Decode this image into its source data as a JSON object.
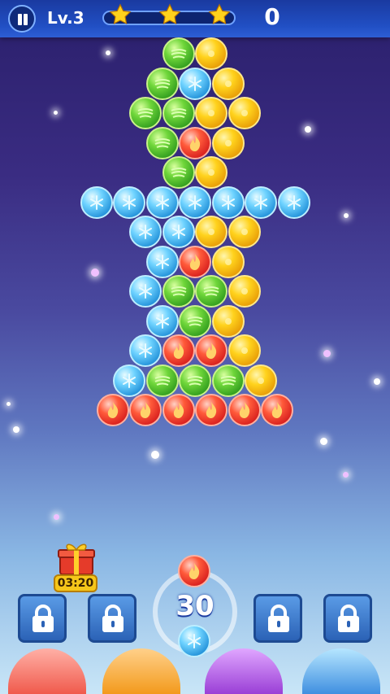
{
  "hud": {
    "level": "Lv.3",
    "score": "0",
    "stars_earned": 0,
    "stars_total": 3,
    "progress": 0.0
  },
  "gift": {
    "timer": "03:20"
  },
  "shooter": {
    "moves": "30",
    "current_bubble": "red",
    "next_bubble": "blue"
  },
  "boosters": [
    {
      "name": "booster-slot-1",
      "locked": true
    },
    {
      "name": "booster-slot-2",
      "locked": true
    },
    {
      "name": "booster-slot-3",
      "locked": true
    },
    {
      "name": "booster-slot-4",
      "locked": true
    }
  ],
  "colors": {
    "green": "#4cc12a",
    "yellow": "#ffc416",
    "blue": "#3fb4f0",
    "red": "#e8321f"
  },
  "board": [
    [
      "green",
      "yellow"
    ],
    [
      "green",
      "blue",
      "yellow"
    ],
    [
      "green",
      "green",
      "yellow",
      "yellow"
    ],
    [
      "green",
      "red",
      "yellow"
    ],
    [
      "green",
      "yellow"
    ],
    [
      "blue",
      "blue",
      "blue",
      "blue",
      "blue",
      "blue",
      "blue"
    ],
    [
      "blue",
      "blue",
      "yellow",
      "yellow"
    ],
    [
      "blue",
      "red",
      "yellow"
    ],
    [
      "blue",
      "green",
      "green",
      "yellow"
    ],
    [
      "blue",
      "green",
      "yellow"
    ],
    [
      "blue",
      "red",
      "red",
      "yellow"
    ],
    [
      "blue",
      "green",
      "green",
      "green",
      "yellow"
    ],
    [
      "red",
      "red",
      "red",
      "red",
      "red",
      "red"
    ]
  ]
}
